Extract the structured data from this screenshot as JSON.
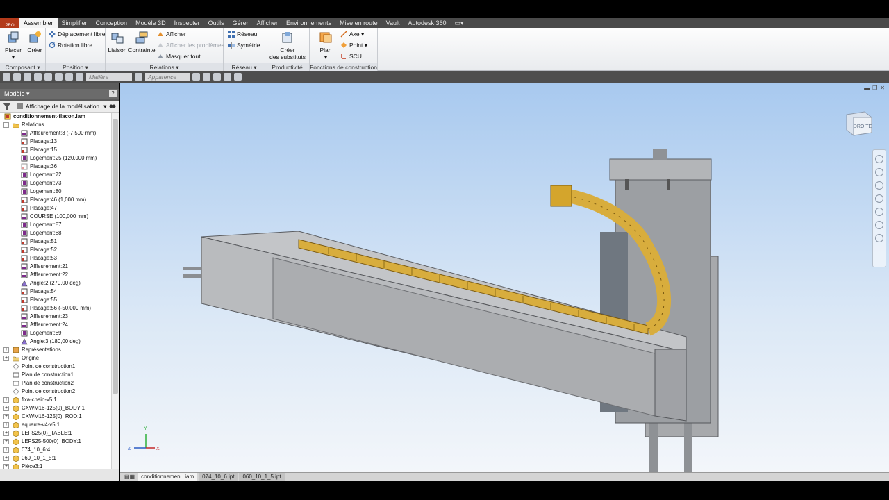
{
  "ribbon": {
    "tabs": [
      "Assembler",
      "Simplifier",
      "Conception",
      "Modèle 3D",
      "Inspecter",
      "Outils",
      "Gérer",
      "Afficher",
      "Environnements",
      "Mise en route",
      "Vault",
      "Autodesk 360"
    ],
    "panels": {
      "composant": "Composant",
      "position": "Position",
      "relations": "Relations",
      "reseau": "Réseau",
      "productivite": "Productivité",
      "fonctions": "Fonctions de construction"
    },
    "buttons": {
      "placer": "Placer",
      "creer": "Créer",
      "deplacement": "Déplacement libre",
      "rotation": "Rotation libre",
      "liaison": "Liaison",
      "contrainte": "Contrainte",
      "afficher": "Afficher",
      "afficher_problemes": "Afficher les problèmes",
      "masquer_tout": "Masquer tout",
      "reseau": "Réseau",
      "symetrie": "Symétrie",
      "substituts_1": "Créer",
      "substituts_2": "des substituts",
      "plan": "Plan",
      "axe": "Axe",
      "point": "Point",
      "scu": "SCU"
    }
  },
  "quickaccess": {
    "material": "Matière",
    "appearance": "Apparence"
  },
  "browser": {
    "title": "Modèle",
    "view_mode": "Affichage de la modélisation",
    "help": "?",
    "items": [
      {
        "label": "conditionnement-flacon.iam",
        "indent": 0,
        "icon": "assembly",
        "bold": true
      },
      {
        "label": "Relations",
        "indent": 1,
        "icon": "folder-open"
      },
      {
        "label": "Affleurement:3 (-7,500 mm)",
        "indent": 2,
        "icon": "flush"
      },
      {
        "label": "Placage:13",
        "indent": 2,
        "icon": "mate"
      },
      {
        "label": "Placage:15",
        "indent": 2,
        "icon": "mate"
      },
      {
        "label": "Logement:25 (120,000 mm)",
        "indent": 2,
        "icon": "insert"
      },
      {
        "label": "Placage:36",
        "indent": 2,
        "icon": "mate-light"
      },
      {
        "label": "Logement:72",
        "indent": 2,
        "icon": "insert"
      },
      {
        "label": "Logement:73",
        "indent": 2,
        "icon": "insert"
      },
      {
        "label": "Logement:80",
        "indent": 2,
        "icon": "insert"
      },
      {
        "label": "Placage:46 (1,000 mm)",
        "indent": 2,
        "icon": "mate"
      },
      {
        "label": "Placage:47",
        "indent": 2,
        "icon": "mate"
      },
      {
        "label": "COURSE (100,000 mm)",
        "indent": 2,
        "icon": "flush"
      },
      {
        "label": "Logement:87",
        "indent": 2,
        "icon": "insert"
      },
      {
        "label": "Logement:88",
        "indent": 2,
        "icon": "insert"
      },
      {
        "label": "Placage:51",
        "indent": 2,
        "icon": "mate"
      },
      {
        "label": "Placage:52",
        "indent": 2,
        "icon": "mate"
      },
      {
        "label": "Placage:53",
        "indent": 2,
        "icon": "mate"
      },
      {
        "label": "Affleurement:21",
        "indent": 2,
        "icon": "flush"
      },
      {
        "label": "Affleurement:22",
        "indent": 2,
        "icon": "flush"
      },
      {
        "label": "Angle:2 (270,00 deg)",
        "indent": 2,
        "icon": "angle"
      },
      {
        "label": "Placage:54",
        "indent": 2,
        "icon": "mate"
      },
      {
        "label": "Placage:55",
        "indent": 2,
        "icon": "mate"
      },
      {
        "label": "Placage:56 (-50,000 mm)",
        "indent": 2,
        "icon": "mate"
      },
      {
        "label": "Affleurement:23",
        "indent": 2,
        "icon": "flush"
      },
      {
        "label": "Affleurement:24",
        "indent": 2,
        "icon": "flush"
      },
      {
        "label": "Logement:89",
        "indent": 2,
        "icon": "insert"
      },
      {
        "label": "Angle:3 (180,00 deg)",
        "indent": 2,
        "icon": "angle"
      },
      {
        "label": "Représentations",
        "indent": 1,
        "icon": "representations"
      },
      {
        "label": "Origine",
        "indent": 1,
        "icon": "folder"
      },
      {
        "label": "Point de construction1",
        "indent": 1,
        "icon": "workpoint"
      },
      {
        "label": "Plan de construction1",
        "indent": 1,
        "icon": "workplane"
      },
      {
        "label": "Plan de construction2",
        "indent": 1,
        "icon": "workplane"
      },
      {
        "label": "Point de construction2",
        "indent": 1,
        "icon": "workpoint"
      },
      {
        "label": "fixa-chain-v5:1",
        "indent": 1,
        "icon": "part"
      },
      {
        "label": "CXWM16-125(0)_BODY:1",
        "indent": 1,
        "icon": "part"
      },
      {
        "label": "CXWM16-125(0)_ROD:1",
        "indent": 1,
        "icon": "part"
      },
      {
        "label": "equerre-v4-v5:1",
        "indent": 1,
        "icon": "part"
      },
      {
        "label": "LEFS25(0)_TABLE:1",
        "indent": 1,
        "icon": "part"
      },
      {
        "label": "LEFS25-500(0)_BODY:1",
        "indent": 1,
        "icon": "part"
      },
      {
        "label": "074_10_6:4",
        "indent": 1,
        "icon": "part"
      },
      {
        "label": "060_10_1_5:1",
        "indent": 1,
        "icon": "part"
      },
      {
        "label": "Pièce3:1",
        "indent": 1,
        "icon": "part"
      }
    ]
  },
  "viewport": {
    "viewcube_label": "DROITE",
    "triad": {
      "x": "X",
      "y": "Y",
      "z": "Z"
    }
  },
  "doc_tabs": [
    "conditionnemen...iam",
    "074_10_6.ipt",
    "060_10_1_5.ipt"
  ],
  "colors": {
    "chain": "#d4a52c",
    "steel": "#9a9da2",
    "sky": "#a8c9ef"
  }
}
